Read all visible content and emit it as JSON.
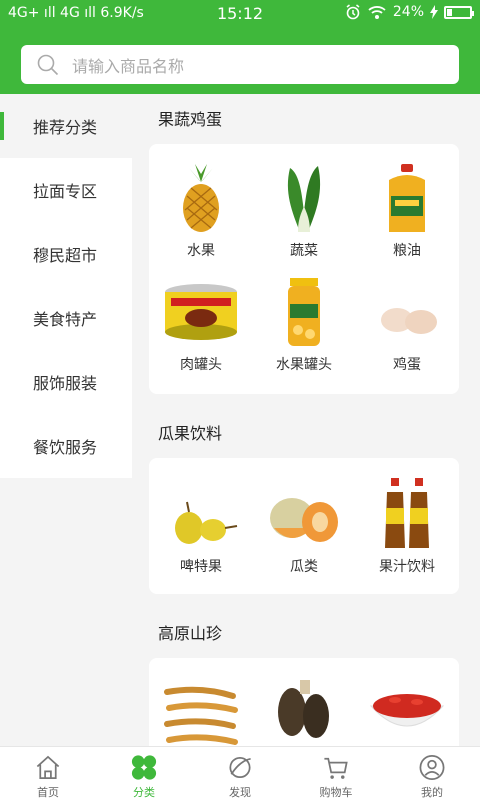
{
  "status_bar": {
    "left": "4G+ ıll 4G ıll 6.9K/s",
    "time": "15:12",
    "battery_text": "24%",
    "battery_level": 0.24
  },
  "search": {
    "placeholder": "请输入商品名称"
  },
  "sidebar": {
    "items": [
      {
        "label": "推荐分类",
        "active": true
      },
      {
        "label": "拉面专区"
      },
      {
        "label": "穆民超市"
      },
      {
        "label": "美食特产"
      },
      {
        "label": "服饰服装"
      },
      {
        "label": "餐饮服务"
      }
    ]
  },
  "sections": [
    {
      "title": "果蔬鸡蛋",
      "items": [
        {
          "label": "水果",
          "icon": "pineapple-icon"
        },
        {
          "label": "蔬菜",
          "icon": "bok-choy-icon"
        },
        {
          "label": "粮油",
          "icon": "oil-bottle-icon"
        },
        {
          "label": "肉罐头",
          "icon": "meat-can-icon"
        },
        {
          "label": "水果罐头",
          "icon": "fruit-jar-icon"
        },
        {
          "label": "鸡蛋",
          "icon": "eggs-icon"
        }
      ]
    },
    {
      "title": "瓜果饮料",
      "items": [
        {
          "label": "啤特果",
          "icon": "pear-icon"
        },
        {
          "label": "瓜类",
          "icon": "melon-icon"
        },
        {
          "label": "果汁饮料",
          "icon": "juice-bottles-icon"
        }
      ]
    },
    {
      "title": "高原山珍",
      "items": [
        {
          "label": "",
          "icon": "cordyceps-icon"
        },
        {
          "label": "",
          "icon": "morel-mushroom-icon"
        },
        {
          "label": "",
          "icon": "goji-berries-icon"
        }
      ]
    }
  ],
  "tabbar": {
    "tabs": [
      {
        "label": "首页",
        "icon": "home-icon"
      },
      {
        "label": "分类",
        "icon": "category-icon",
        "active": true
      },
      {
        "label": "发现",
        "icon": "discover-icon"
      },
      {
        "label": "购物车",
        "icon": "cart-icon"
      },
      {
        "label": "我的",
        "icon": "profile-icon"
      }
    ]
  },
  "colors": {
    "brand": "#3fb83b",
    "background": "#f4f4f4"
  }
}
